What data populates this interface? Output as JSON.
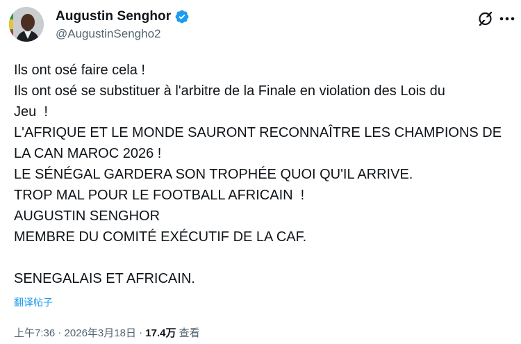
{
  "author": {
    "display_name": "Augustin Senghor",
    "handle": "@AugustinSengho2",
    "verified_color": "#1d9bf0"
  },
  "icons": {
    "grok": "grok-icon",
    "more": "more-options-icon",
    "verified": "verified-badge-icon"
  },
  "tweet": {
    "lines": [
      "Ils ont osé faire cela !",
      "Ils ont osé se substituer à l'arbitre de la Finale en violation des Lois du",
      "Jeu  !",
      "L'AFRIQUE ET LE MONDE SAURONT RECONNAÎTRE LES CHAMPIONS DE",
      "LA CAN MAROC 2026 !",
      "LE SÉNÉGAL GARDERA SON TROPHÉE QUOI QU'IL ARRIVE.",
      "TROP MAL POUR LE FOOTBALL AFRICAIN  !",
      "AUGUSTIN SENGHOR",
      "MEMBRE DU COMITÉ EXÉCUTIF DE LA CAF.",
      "",
      "SENEGALAIS ET AFRICAIN."
    ],
    "translate_label": "翻译帖子"
  },
  "meta": {
    "time": "上午7:36",
    "separator": " · ",
    "date": "2026年3月18日",
    "views_count": "17.4万",
    "views_label": " 查看"
  },
  "colors": {
    "text_primary": "#0f1419",
    "text_secondary": "#536471",
    "link": "#1d9bf0"
  }
}
